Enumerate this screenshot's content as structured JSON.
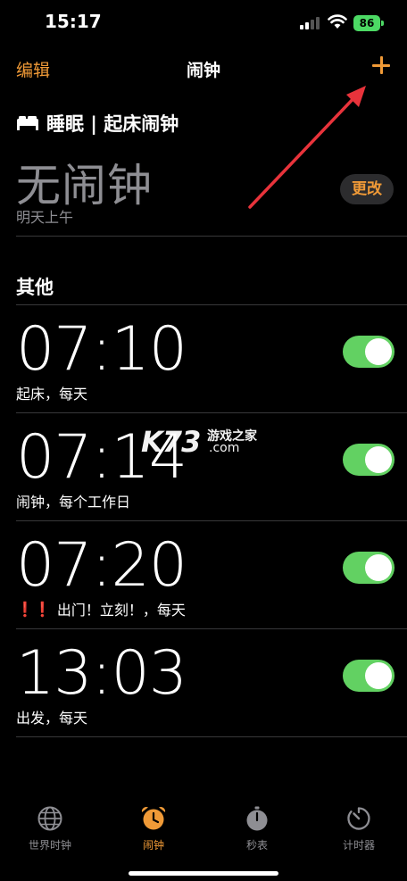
{
  "status": {
    "time": "15:17",
    "battery": "86"
  },
  "nav": {
    "edit": "编辑",
    "title": "闹钟"
  },
  "sleep": {
    "title": "睡眠 | 起床闹钟",
    "no_alarm": "无闹钟",
    "when": "明天上午",
    "change": "更改"
  },
  "other_title": "其他",
  "alarms": [
    {
      "time": "07:10",
      "label": "起床，每天",
      "on": true
    },
    {
      "time": "07:14",
      "label": "闹钟，每个工作日",
      "on": true
    },
    {
      "time": "07:20",
      "label": "出门！立刻！，每天",
      "prefix": "❗❗",
      "on": true
    },
    {
      "time": "13:03",
      "label": "出发，每天",
      "on": true
    }
  ],
  "watermark": {
    "logo": "K73",
    "site": "游戏之家",
    "domain": ".com"
  },
  "tabs": [
    {
      "label": "世界时钟",
      "icon": "globe-icon"
    },
    {
      "label": "闹钟",
      "icon": "alarm-clock-icon",
      "active": true
    },
    {
      "label": "秒表",
      "icon": "stopwatch-icon"
    },
    {
      "label": "计时器",
      "icon": "timer-icon"
    }
  ],
  "colors": {
    "accent": "#f09a37",
    "toggle_on": "#62d162",
    "muted": "#8e8e93",
    "warning": "#ff3b30",
    "arrow": "#e8333b"
  }
}
